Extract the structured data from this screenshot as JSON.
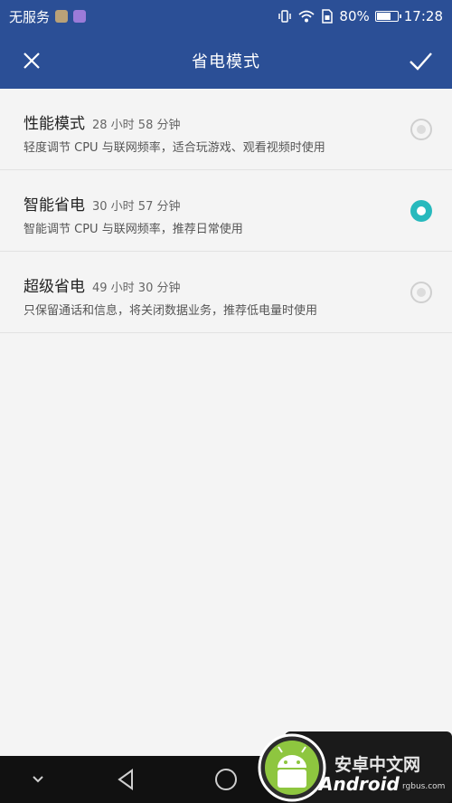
{
  "status_bar": {
    "carrier": "无服务",
    "battery_percent_text": "80%",
    "battery_level": 0.8,
    "time": "17:28",
    "icons": [
      "vibrate-icon",
      "wifi-icon",
      "sim-icon",
      "battery-icon"
    ]
  },
  "header": {
    "title": "省电模式",
    "close_icon": "close-icon",
    "confirm_icon": "check-icon",
    "background": "#2b4f96"
  },
  "modes": [
    {
      "name": "性能模式",
      "time": "28 小时 58 分钟",
      "desc": "轻度调节 CPU 与联网频率，适合玩游戏、观看视频时使用",
      "selected": false
    },
    {
      "name": "智能省电",
      "time": "30 小时 57 分钟",
      "desc": "智能调节 CPU 与联网频率，推荐日常使用",
      "selected": true
    },
    {
      "name": "超级省电",
      "time": "49 小时 30 分钟",
      "desc": "只保留通话和信息，将关闭数据业务，推荐低电量时使用",
      "selected": false
    }
  ],
  "accent_color": "#27b9bd",
  "nav_bar": {
    "buttons": [
      "chevron-down-icon",
      "back-icon",
      "home-icon"
    ]
  },
  "watermark": {
    "line1": "安卓中文网",
    "line2": "Android",
    "line3": "rgbus.com"
  }
}
